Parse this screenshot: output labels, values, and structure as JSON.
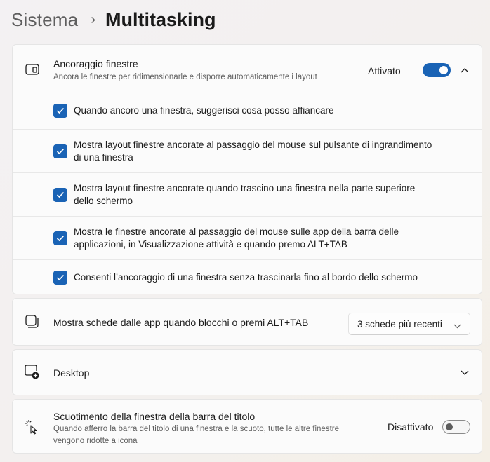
{
  "breadcrumb": {
    "parent": "Sistema",
    "separator": "›",
    "current": "Multitasking"
  },
  "snap": {
    "title": "Ancoraggio finestre",
    "description": "Ancora le finestre per ridimensionarle e disporre automaticamente i layout",
    "state": "Attivato",
    "enabled": true,
    "icon": "snap-layout-icon",
    "options": [
      {
        "line1": "Quando ancoro una finestra, suggerisci cosa posso affiancare",
        "line2": "",
        "checked": true
      },
      {
        "line1": "Mostra layout finestre ancorate al passaggio del mouse sul pulsante di ingrandimento",
        "line2": "di una finestra",
        "checked": true
      },
      {
        "line1": "Mostra layout finestre ancorate quando trascino una finestra nella parte superiore",
        "line2": "dello schermo",
        "checked": true
      },
      {
        "line1": "Mostra le finestre ancorate al passaggio del mouse sulle app della barra delle",
        "line2": "applicazioni, in Visualizzazione attività e quando premo ALT+TAB",
        "checked": true
      },
      {
        "line1": "Consenti l’ancoraggio di una finestra senza trascinarla fino al bordo dello schermo",
        "line2": "",
        "checked": true
      }
    ]
  },
  "tabs": {
    "title": "Mostra schede dalle app quando blocchi o premi ALT+TAB",
    "selected": "3 schede più recenti",
    "icon": "app-tabs-icon"
  },
  "desktop": {
    "title": "Desktop",
    "icon": "desktop-add-icon"
  },
  "shake": {
    "title": "Scuotimento della finestra della barra del titolo",
    "description_line1": "Quando afferro la barra del titolo di una finestra e la scuoto, tutte le altre finestre",
    "description_line2": "vengono ridotte a icona",
    "state": "Disattivato",
    "enabled": false,
    "icon": "shake-cursor-icon"
  },
  "colors": {
    "accent": "#1a63b5",
    "card": "#fbfbfb",
    "border": "#e5e5e5"
  }
}
